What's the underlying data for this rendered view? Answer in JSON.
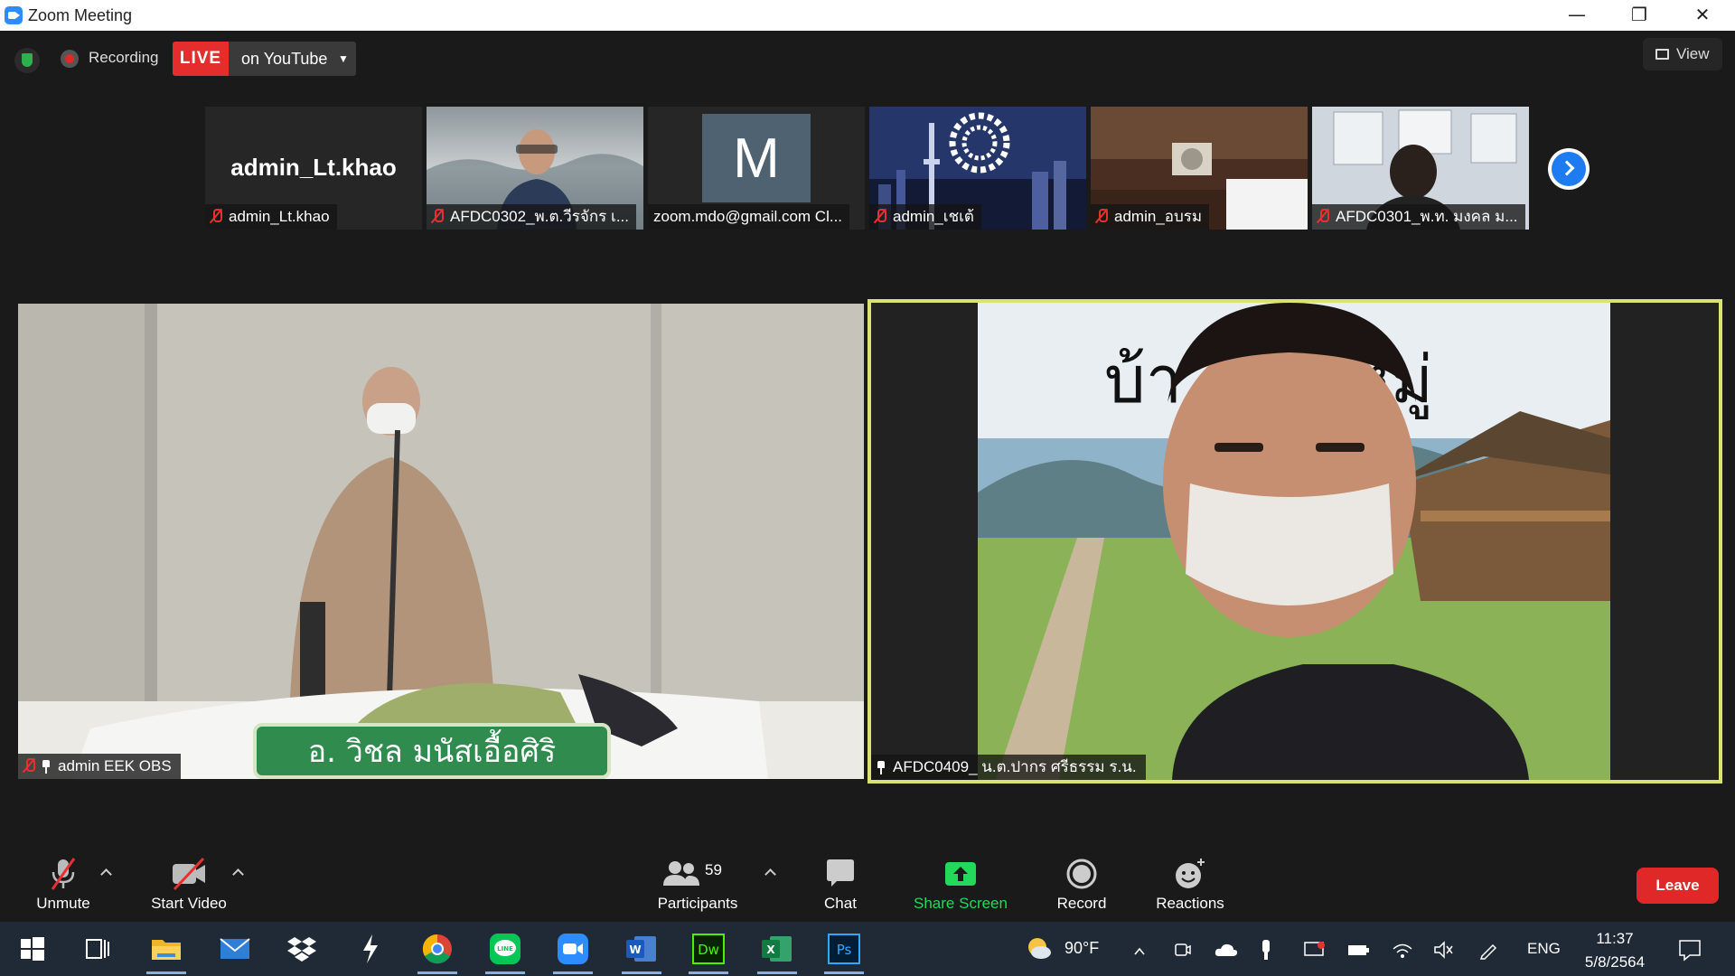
{
  "window": {
    "title": "Zoom Meeting",
    "controls": {
      "minimize": "—",
      "restore": "❐",
      "close": "✕"
    }
  },
  "topbar": {
    "security_icon": "shield-check-icon",
    "recording_label": "Recording",
    "live_badge": "LIVE",
    "live_destination": "on YouTube",
    "live_caret": "▼",
    "view_label": "View"
  },
  "thumbnails": [
    {
      "name": "admin_Lt.khao",
      "display_name": "admin_Lt.khao",
      "muted": true,
      "type": "name"
    },
    {
      "name": "AFDC0302_พ.ต.วีรจักร  เ...",
      "muted": true,
      "type": "video"
    },
    {
      "name": "zoom.mdo@gmail.com Cl...",
      "muted": false,
      "type": "avatar",
      "avatar_letter": "M"
    },
    {
      "name": "admin_เชเต้",
      "muted": true,
      "type": "video"
    },
    {
      "name": "admin_อบรม",
      "muted": true,
      "type": "video"
    },
    {
      "name": "AFDC0301_พ.ท. มงคล  ม...",
      "muted": true,
      "type": "video"
    }
  ],
  "tiles": {
    "left": {
      "name": "admin EEK OBS",
      "nameplate": "อ. วิชล  มนัสเอื้อศิริ"
    },
    "right": {
      "name": "AFDC0409_ น.ต.ปากร ศรีธรรม ร.น.",
      "background_text": "บ้า            มนา หมู่"
    }
  },
  "toolbar": {
    "unmute": "Unmute",
    "start_video": "Start Video",
    "participants": "Participants",
    "participants_count": "59",
    "chat": "Chat",
    "share_screen": "Share Screen",
    "record": "Record",
    "reactions": "Reactions",
    "leave": "Leave"
  },
  "colors": {
    "live_red": "#e42d2d",
    "leave_red": "#e02828",
    "share_green": "#23d959",
    "active_speaker_border": "#d9e36f",
    "zoom_blue": "#2d8cff"
  },
  "taskbar": {
    "apps": [
      "windows-start-icon",
      "task-view-icon",
      "file-explorer-icon",
      "mail-icon",
      "dropbox-icon",
      "app-icon",
      "chrome-icon",
      "line-icon",
      "zoom-icon",
      "word-icon",
      "dreamweaver-icon",
      "excel-icon",
      "photoshop-icon"
    ],
    "app_labels": {
      "dw": "Dw",
      "ps": "Ps",
      "word": "W",
      "excel": "X",
      "line": "LINE"
    },
    "weather": "90°F",
    "language": "ENG",
    "time": "11:37",
    "date": "5/8/2564"
  }
}
